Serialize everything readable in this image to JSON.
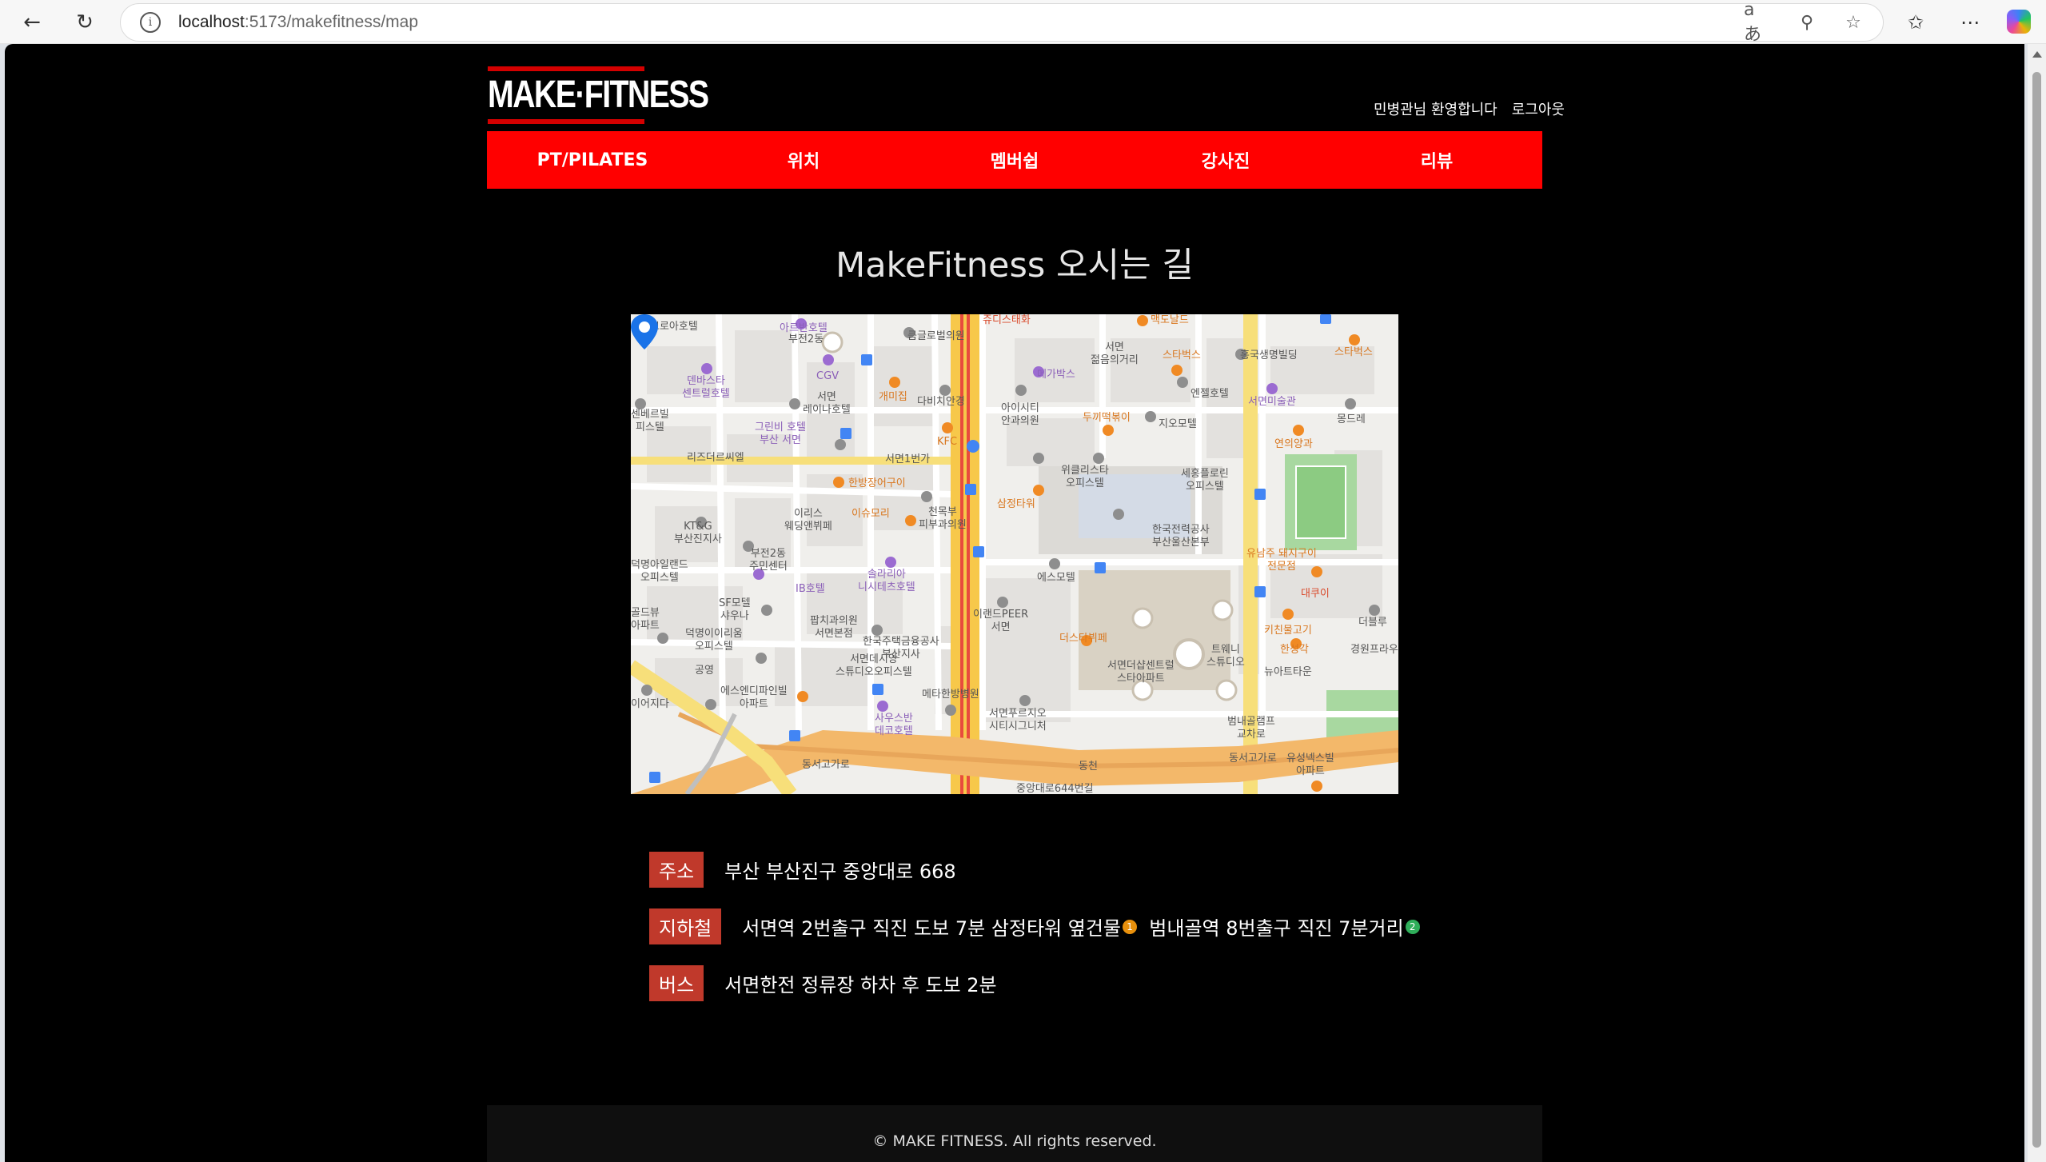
{
  "browser": {
    "url_host": "localhost",
    "url_path": ":5173/makefitness/map"
  },
  "site": {
    "logo_text": "MAKE·FITNESS",
    "welcome": "민병관님 환영합니다",
    "logout": "로그아웃",
    "menu": [
      {
        "label": "PT/PILATES"
      },
      {
        "label": "위치"
      },
      {
        "label": "멤버쉽"
      },
      {
        "label": "강사진"
      },
      {
        "label": "리뷰"
      }
    ]
  },
  "page": {
    "title": "MakeFitness 오시는 길"
  },
  "map": {
    "labels": {
      "l1": "브로아호텔",
      "l2": "아르반호텔",
      "l3": "부전2동",
      "l4": "큼글로벌의원",
      "l5": "쥬디스태화",
      "l6": "맥도날드",
      "l7": "서면\n젊음의거리",
      "l8": "홍국생명빌딩",
      "l9": "스타벅스",
      "l10": "스타벅스",
      "l11": "CGV",
      "l12": "덴바스타\n센트럴호텔",
      "l13": "서면\n레이나호텔",
      "l14": "개미집",
      "l15": "다비치안경",
      "l16": "메가박스",
      "l17": "엔젤호텔",
      "l18": "서면미술관",
      "l19": "아이시티\n안과의원",
      "l20": "두끼떡볶이",
      "l21": "지오모텔",
      "l22": "몽드레",
      "l23": "그린비 호텔\n부산 서면",
      "l24": "KFC",
      "l25": "연의양과",
      "l26": "리즈더르씨엘",
      "l27": "서면1번가",
      "l28": "한방장어구이",
      "l29": "위클리스타\n오피스텔",
      "l30": "세홍플로린\n오피스텔",
      "l31": "삼정타워",
      "l32": "KT&G\n부산진지사",
      "l33": "이리스\n웨딩앤뷔페",
      "l34": "이슈모리",
      "l35": "천목부\n피부과의원",
      "l36": "한국전력공사\n부산울산본부",
      "l37": "부전2동\n주민센터",
      "l38": "솔라리아\n니시테츠호텔",
      "l39": "유남주 돼지구이\n전문점",
      "l40": "에스모텔",
      "l41": "IB호텔",
      "l42": "대쿠이",
      "l43": "SF모텔\n샤우나",
      "l44": "팝치과의원\n서면본점",
      "l45": "이랜드PEER\n서면",
      "l46": "더스타뷔페",
      "l47": "키친물고기",
      "l48": "더블루",
      "l49": "덕명이이리움\n오피스텔",
      "l50": "한국주택금융공사\n부산지사",
      "l51": "한성각",
      "l52": "경원프라우",
      "l53": "서면데시앙\n스튜디오오피스텔",
      "l54": "서면더샵센트럴\n스타아파트",
      "l55": "트웨니\n스튜디오",
      "l56": "뉴아트타운",
      "l57": "공영",
      "l58": "에스엔디파인빌\n아파트",
      "l59": "메타한방병원",
      "l60": "서면푸르지오\n시티시그니처",
      "l61": "범내골램프\n교차로",
      "l62": "사우스반\n데코호텔",
      "l63": "동서고가로",
      "l64": "동서고가로",
      "l65": "유성넥스빌\n아파트",
      "l66": "중앙대로644번길",
      "l67": "덕명아일랜드\n오피스텔",
      "l68": "골드뷰\n아파트",
      "l69": "이어지다",
      "l70": "센베르빌\n피스텔",
      "l71": "동천"
    }
  },
  "info": {
    "address_badge": "주소",
    "address_text": "부산 부산진구 중앙대로 668",
    "subway_badge": "지하철",
    "subway_text_1": "서면역 2번출구 직진 도보 7분 삼정타워 옆건물",
    "subway_line_1": "1",
    "subway_text_2": "범내골역 8번출구 직진 7분거리",
    "subway_line_2": "2",
    "bus_badge": "버스",
    "bus_text": "서면한전 정류장 하차 후 도보 2분"
  },
  "footer": {
    "copyright": "© MAKE FITNESS. All rights reserved."
  },
  "colors": {
    "menu_bg": "#ff0000",
    "badge_bg": "#c0392b",
    "page_bg": "#000000"
  }
}
